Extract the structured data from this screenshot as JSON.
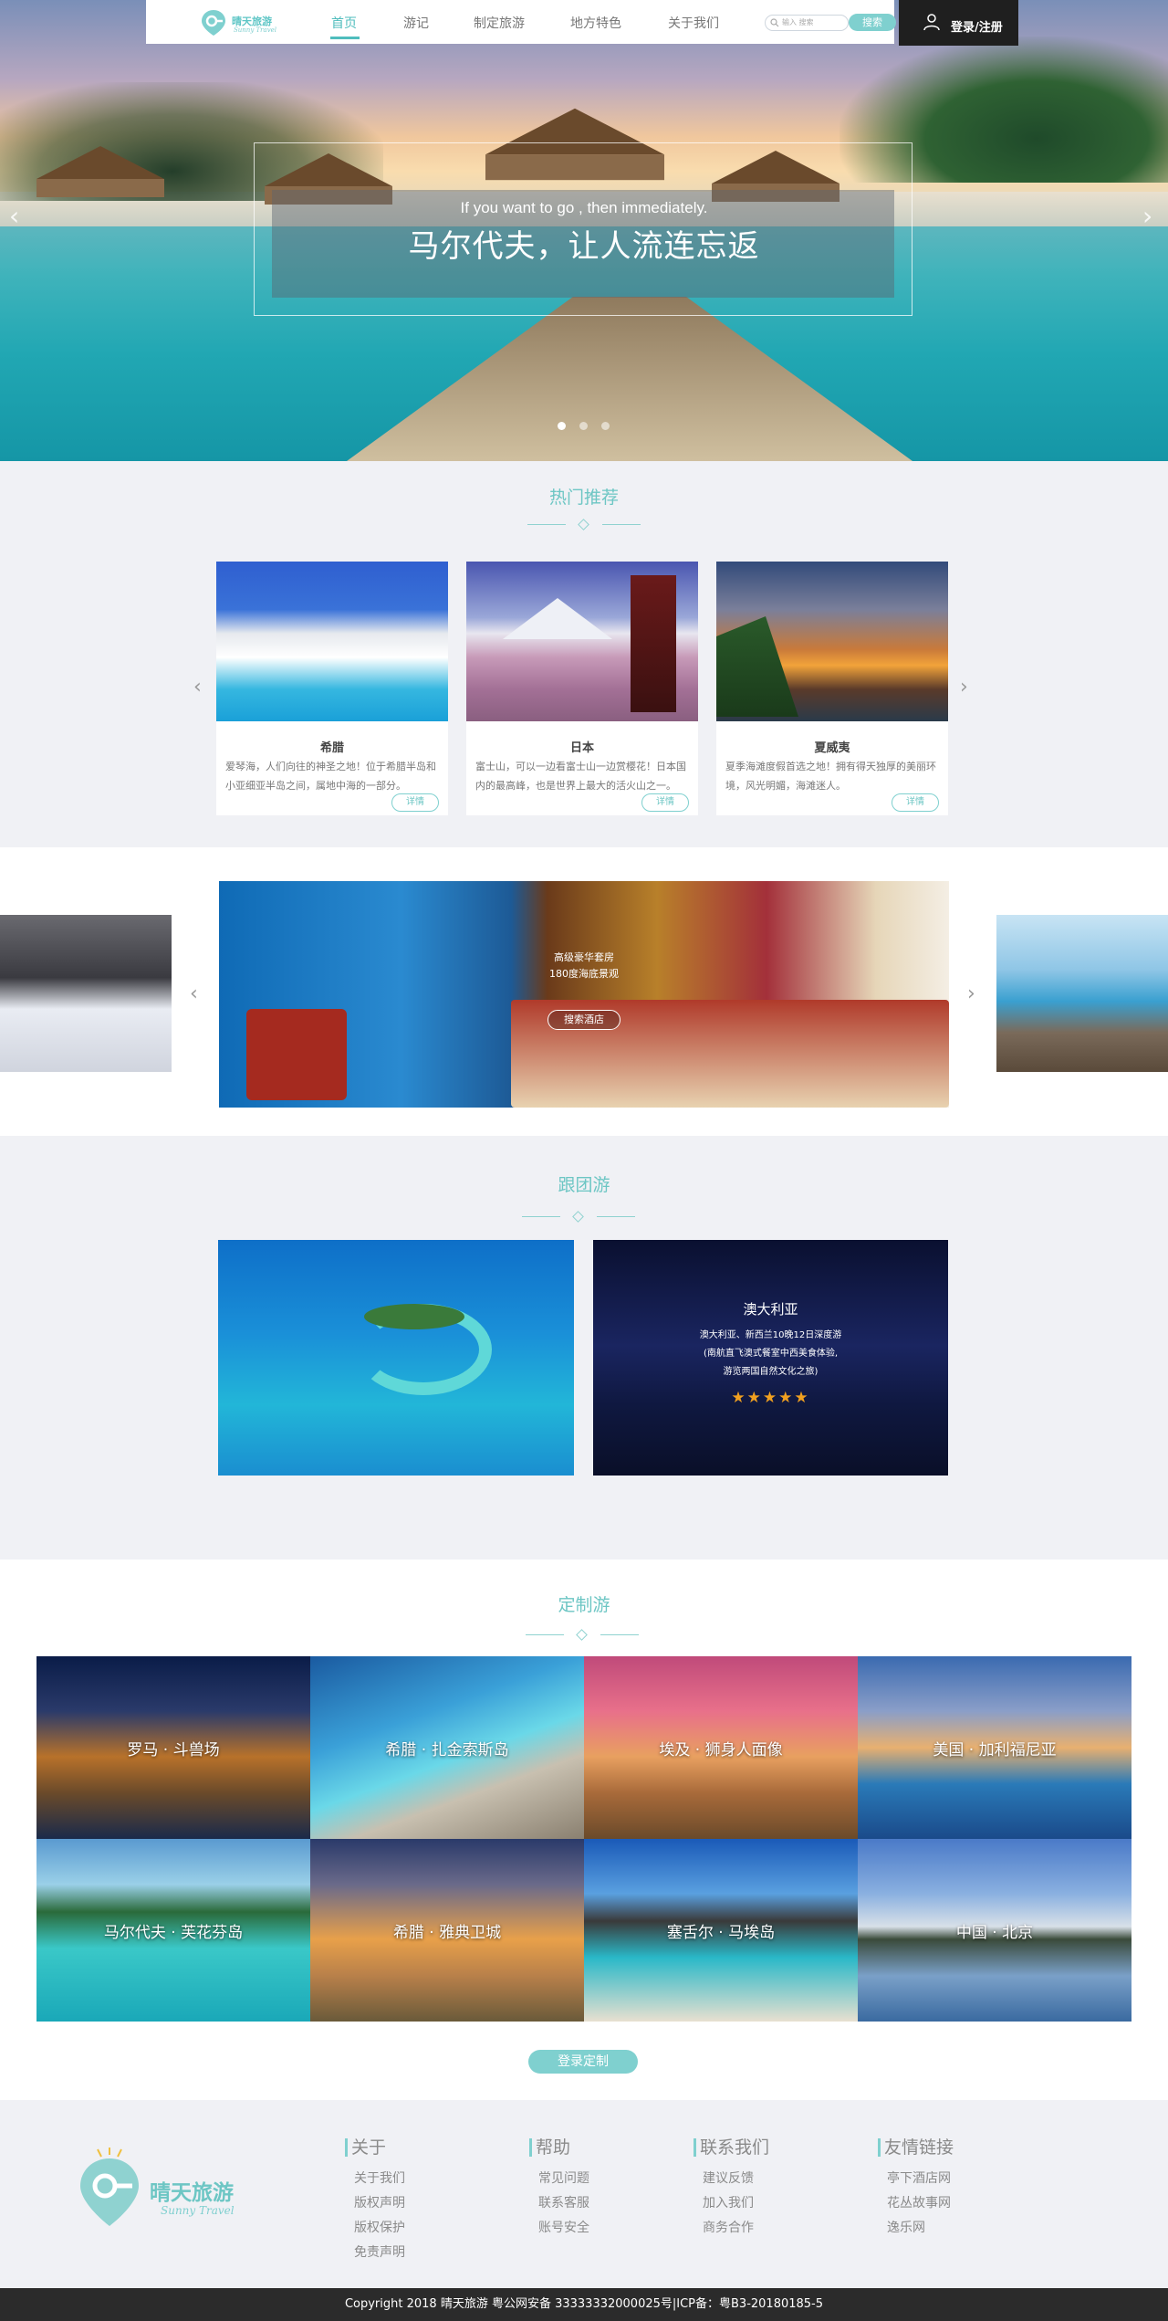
{
  "header": {
    "logo_cn": "晴天旅游",
    "logo_en": "Sunny Travel",
    "nav": [
      "首页",
      "游记",
      "制定旅游",
      "地方特色",
      "关于我们"
    ],
    "search_placeholder": "输入 搜索",
    "search_button": "搜索",
    "login": "登录/注册"
  },
  "hero": {
    "subtitle": "If you want to go , then immediately.",
    "title": "马尔代夫，让人流连忘返",
    "prev": "‹",
    "next": "›"
  },
  "hot": {
    "title": "热门推荐",
    "prev": "‹",
    "next": "›",
    "cards": [
      {
        "title": "希腊",
        "desc": "爱琴海，人们向往的神圣之地！位于希腊半岛和小亚细亚半岛之间，属地中海的一部分。",
        "more": "详情"
      },
      {
        "title": "日本",
        "desc": "富士山，可以一边看富士山一边赏樱花！日本国内的最高峰，也是世界上最大的活火山之一。",
        "more": "详情"
      },
      {
        "title": "夏威夷",
        "desc": "夏季海滩度假首选之地！拥有得天独厚的美丽环境，风光明媚，海滩迷人。",
        "more": "详情"
      }
    ]
  },
  "hotel": {
    "caption_line1": "高级豪华套房",
    "caption_line2": "180度海底景观",
    "button": "搜索酒店",
    "prev": "‹",
    "next": "›"
  },
  "group": {
    "title": "跟团游",
    "card2_title": "澳大利亚",
    "card2_line1": "澳大利亚、新西兰10晚12日深度游",
    "card2_line2": "(南航直飞澳式餐室中西美食体验,",
    "card2_line3": "游览两国自然文化之旅)",
    "card2_stars": "★★★★★"
  },
  "custom": {
    "title": "定制游",
    "tiles": [
      "罗马 · 斗兽场",
      "希腊 · 扎金索斯岛",
      "埃及 · 狮身人面像",
      "美国 · 加利福尼亚",
      "马尔代夫 · 芙花芬岛",
      "希腊 · 雅典卫城",
      "塞舌尔 · 马埃岛",
      "中国 · 北京"
    ],
    "button": "登录定制"
  },
  "footer": {
    "logo_cn": "晴天旅游",
    "logo_en": "Sunny Travel",
    "columns": [
      {
        "title": "关于",
        "links": [
          "关于我们",
          "版权声明",
          "版权保护",
          "免责声明"
        ]
      },
      {
        "title": "帮助",
        "links": [
          "常见问题",
          "联系客服",
          "账号安全"
        ]
      },
      {
        "title": "联系我们",
        "links": [
          "建议反馈",
          "加入我们",
          "商务合作"
        ]
      },
      {
        "title": "友情链接",
        "links": [
          "亭下酒店网",
          "花丛故事网",
          "逸乐网"
        ]
      }
    ],
    "copyright": "Copyright  2018    晴天旅游       粤公网安备 33333332000025号|ICP备：粤B3-20180185-5"
  },
  "colors": {
    "accent": "#6dc6c4",
    "dark": "#1f1f1f",
    "footer_bg": "#f0f1f5"
  }
}
